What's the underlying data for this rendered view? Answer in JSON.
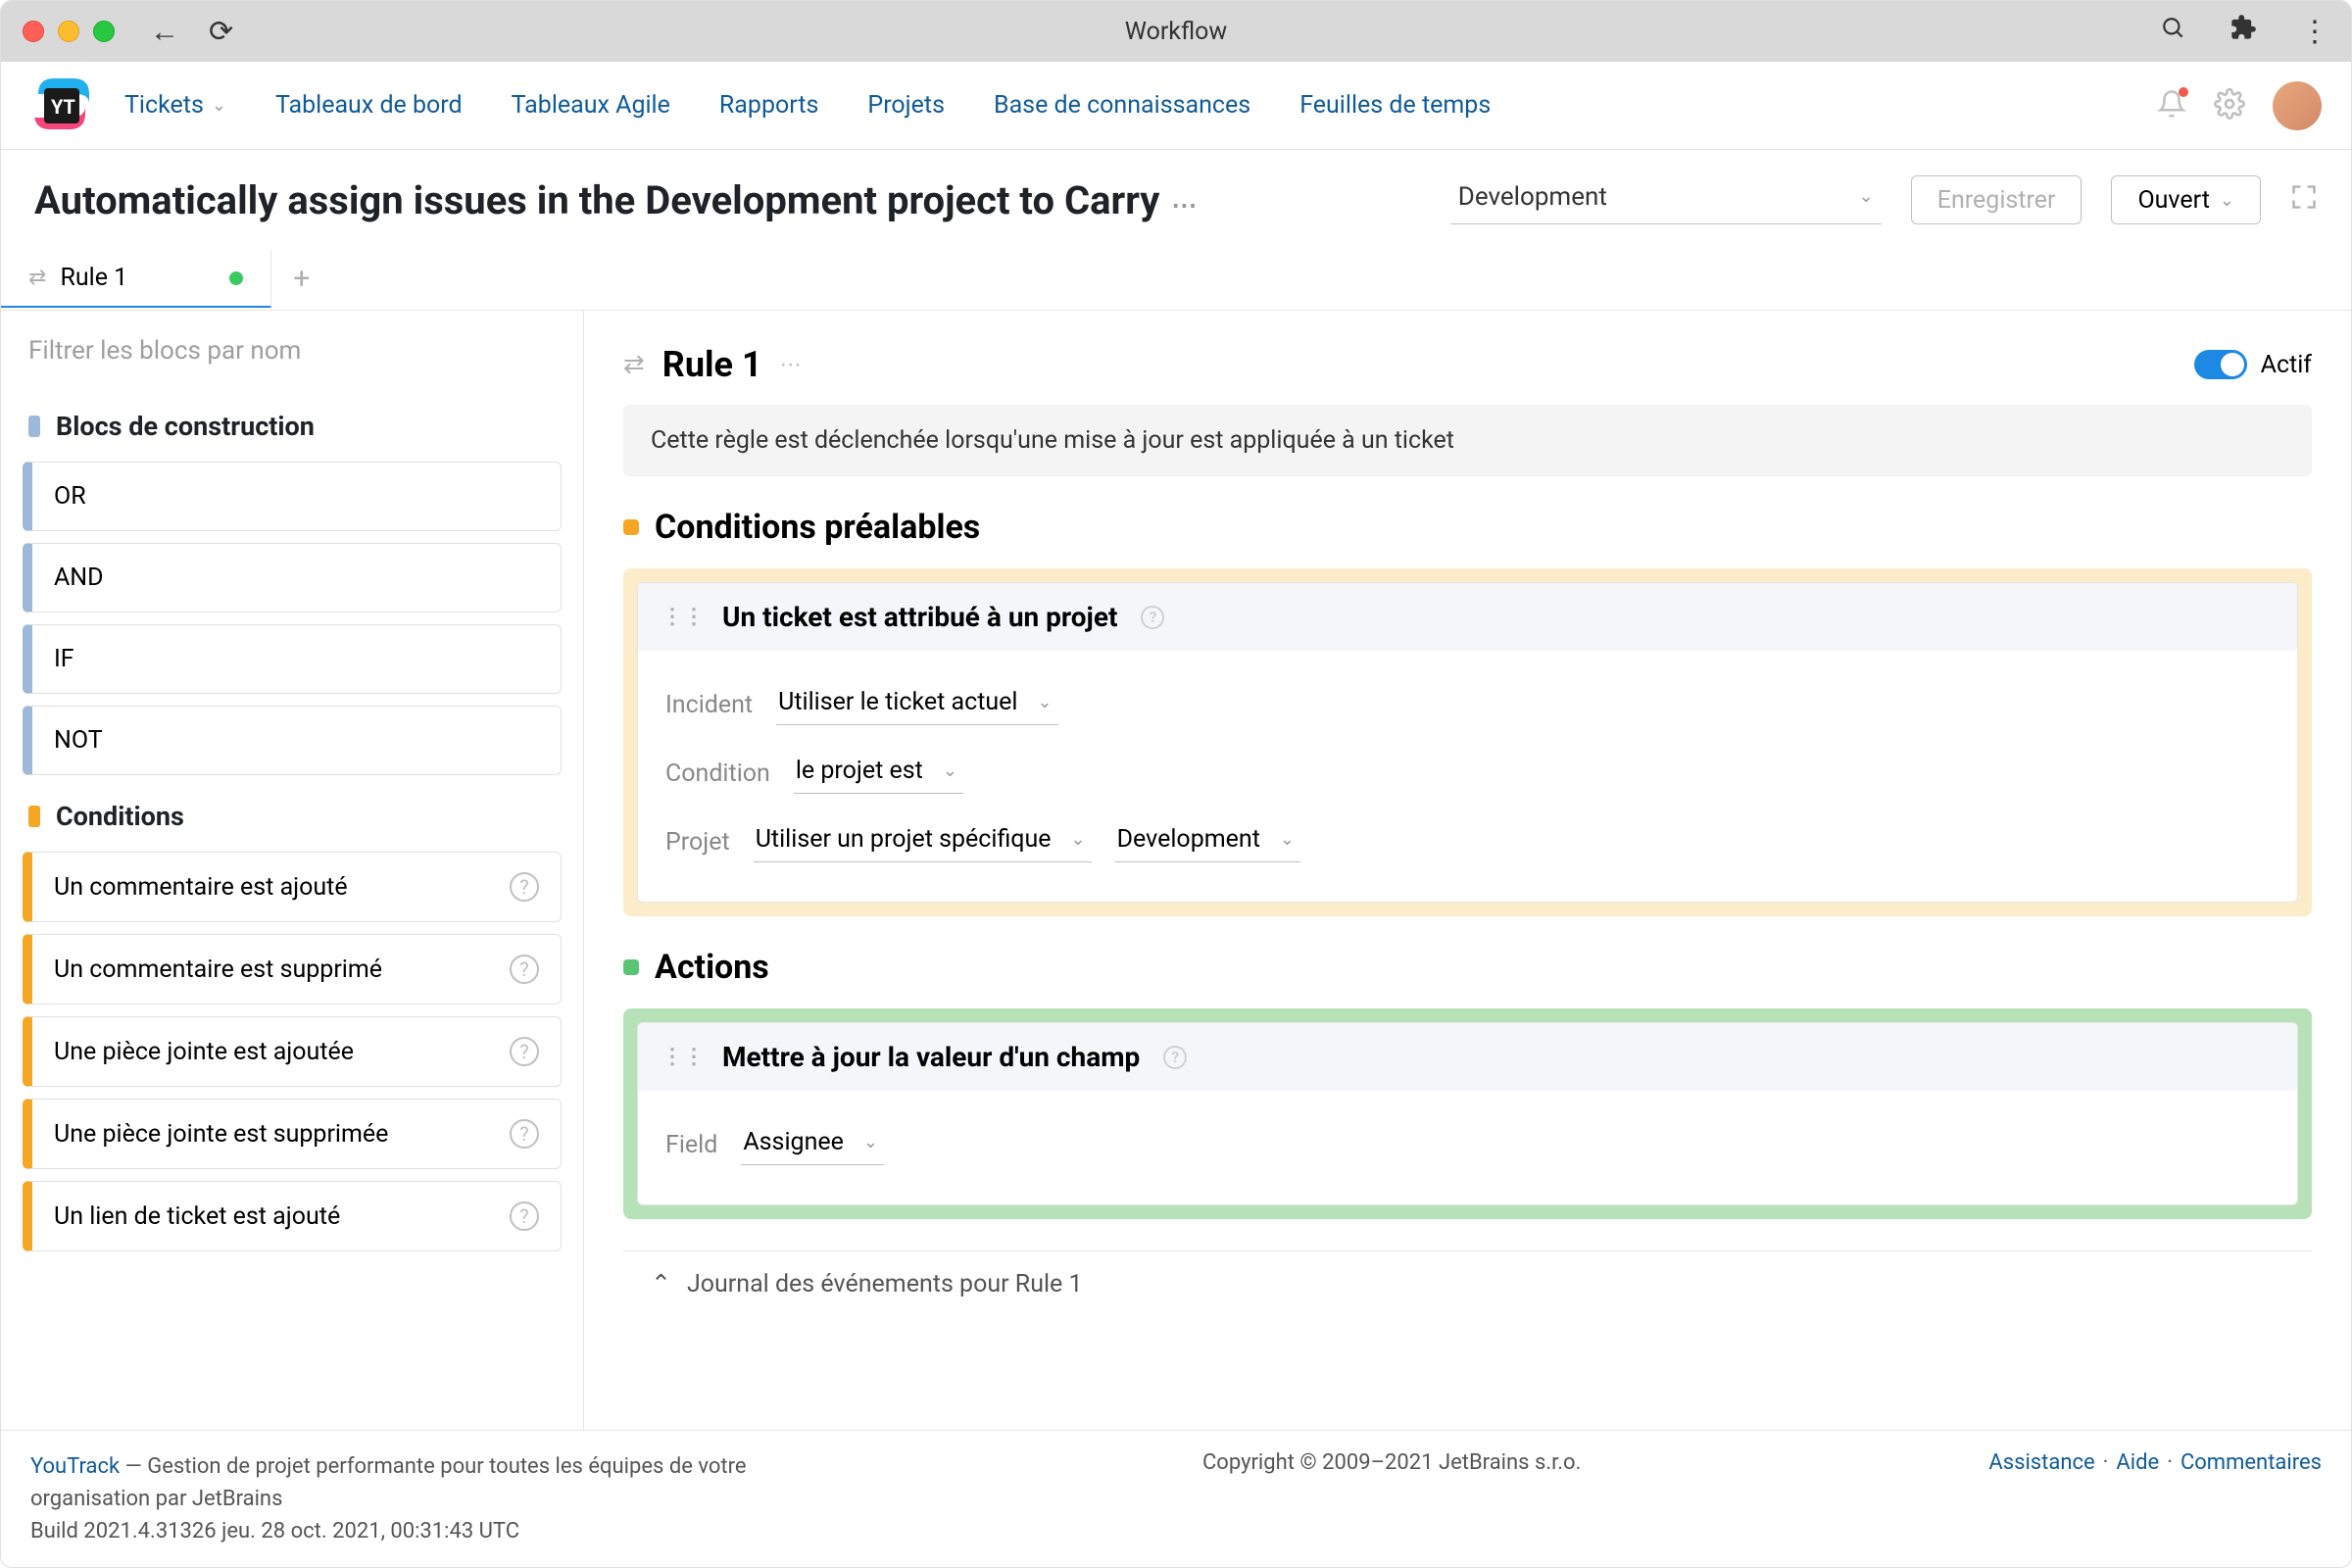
{
  "window": {
    "title": "Workflow"
  },
  "nav": {
    "items": [
      "Tickets",
      "Tableaux de bord",
      "Tableaux Agile",
      "Rapports",
      "Projets",
      "Base de connaissances",
      "Feuilles de temps"
    ]
  },
  "header": {
    "title": "Automatically assign issues in the Development project to Carry",
    "project_selected": "Development",
    "save_label": "Enregistrer",
    "status_label": "Ouvert"
  },
  "tabs": {
    "active": "Rule 1"
  },
  "sidebar": {
    "filter_placeholder": "Filtrer les blocs par nom",
    "groups": {
      "building": {
        "title": "Blocs de construction",
        "items": [
          "OR",
          "AND",
          "IF",
          "NOT"
        ]
      },
      "conditions": {
        "title": "Conditions",
        "items": [
          "Un commentaire est ajouté",
          "Un commentaire est supprimé",
          "Une pièce jointe est ajoutée",
          "Une pièce jointe est supprimée",
          "Un lien de ticket est ajouté"
        ]
      }
    }
  },
  "content": {
    "rule_title": "Rule 1",
    "active_label": "Actif",
    "description": "Cette règle est déclenchée lorsqu'une mise à jour est appliquée à un ticket",
    "prereq_title": "Conditions préalables",
    "actions_title": "Actions",
    "prereq_card": {
      "title": "Un ticket est attribué à un projet",
      "rows": {
        "incident": {
          "label": "Incident",
          "value": "Utiliser le ticket actuel"
        },
        "condition": {
          "label": "Condition",
          "value": "le projet est"
        },
        "project": {
          "label": "Projet",
          "value1": "Utiliser un projet spécifique",
          "value2": "Development"
        }
      }
    },
    "action_card": {
      "title": "Mettre à jour la valeur d'un champ",
      "rows": {
        "field": {
          "label": "Field",
          "value": "Assignee"
        }
      }
    },
    "log_title": "Journal des événements pour Rule 1"
  },
  "footer": {
    "product": "YouTrack",
    "desc_line1": " — Gestion de projet performante pour toutes les équipes de votre organisation par JetBrains",
    "build": "Build 2021.4.31326 jeu. 28 oct. 2021, 00:31:43 UTC",
    "copyright": "Copyright © 2009–2021 JetBrains s.r.o.",
    "links": [
      "Assistance",
      "Aide",
      "Commentaires"
    ]
  }
}
